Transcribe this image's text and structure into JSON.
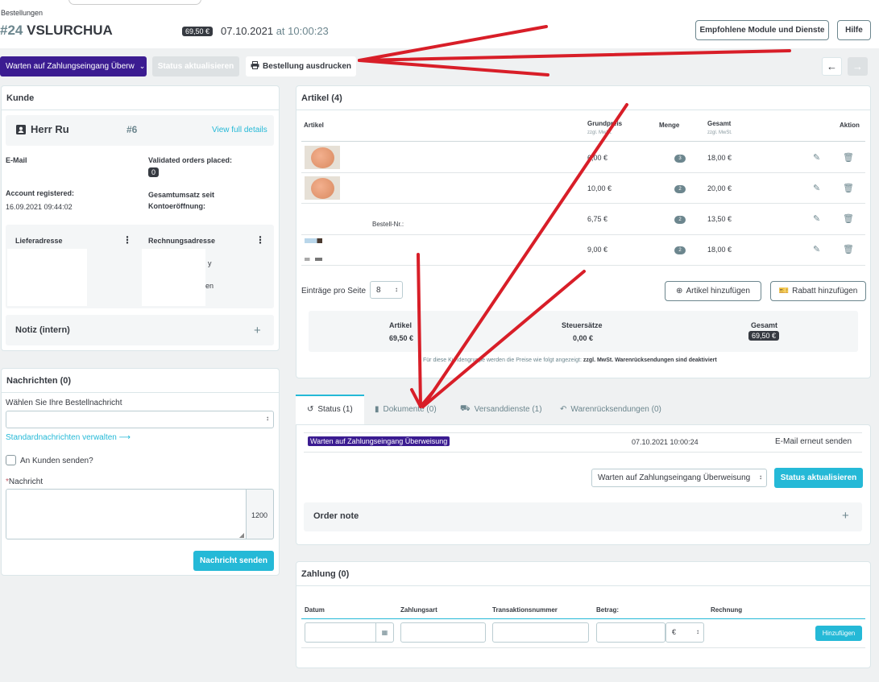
{
  "header": {
    "breadcrumb": "Bestellungen",
    "order_number": "#24",
    "order_reference": "VSLURCHUA",
    "total_badge": "69,50 €",
    "date": "07.10.2021",
    "at": "at",
    "time": "10:00:23",
    "recommended_button": "Empfohlene Module und Dienste",
    "help_button": "Hilfe"
  },
  "actionbar": {
    "status_dropdown": "Warten auf Zahlungseingang Überw",
    "update_status_button": "Status aktualisieren",
    "print_button": "Bestellung ausdrucken",
    "prev_icon": "arrow-left-icon",
    "next_icon": "arrow-right-icon"
  },
  "customer": {
    "title": "Kunde",
    "name": "Herr Ru",
    "id": "#6",
    "view_details": "View full details",
    "email_label": "E-Mail",
    "validated_label": "Validated orders placed:",
    "validated_count": "0",
    "registered_label": "Account registered:",
    "registered_value": "16.09.2021 09:44:02",
    "revenue_label": "Gesamtumsatz seit Kontoeröffnung:",
    "delivery_label": "Lieferadresse",
    "invoice_label": "Rechnungsadresse",
    "invoice_fragment_1": "y",
    "invoice_fragment_2": "en",
    "note_label": "Notiz (intern)",
    "note_add": "+"
  },
  "messages": {
    "title": "Nachrichten (0)",
    "choose_label": "Wählen Sie Ihre Bestellnachricht",
    "manage_link": "Standardnachrichten verwalten",
    "send_to_customer": "An Kunden senden?",
    "message_label": "Nachricht",
    "required_marker": "*",
    "char_count": "1200",
    "send_button": "Nachricht senden"
  },
  "products": {
    "title": "Artikel (4)",
    "col_article": "Artikel",
    "col_unit_price": "Grundpreis",
    "col_unit_price_sub": "zzgl. MwSt.",
    "col_qty": "Menge",
    "col_total": "Gesamt",
    "col_total_sub": "zzgl. MwSt.",
    "col_action": "Aktion",
    "rows": [
      {
        "price": "6,00 €",
        "qty": "3",
        "total": "18,00 €"
      },
      {
        "price": "10,00 €",
        "qty": "2",
        "total": "20,00 €"
      },
      {
        "price": "6,75 €",
        "qty": "2",
        "total": "13,50 €",
        "order_ref": "Bestell-Nr.:"
      },
      {
        "price": "9,00 €",
        "qty": "2",
        "total": "18,00 €"
      }
    ],
    "per_page_label": "Einträge pro Seite",
    "per_page_value": "8",
    "add_product_button": "Artikel hinzufügen",
    "add_discount_button": "Rabatt hinzufügen",
    "summary_articles_label": "Artikel",
    "summary_articles_value": "69,50 €",
    "summary_tax_label": "Steuersätze",
    "summary_tax_value": "0,00 €",
    "summary_total_label": "Gesamt",
    "summary_total_value": "69,50 €",
    "footnote_text": "Für diese Kundengruppe werden die Preise wie folgt angezeigt:",
    "footnote_tax": "zzgl. MwSt.",
    "footnote_returns": "Warenrücksendungen sind deaktiviert"
  },
  "tabs": [
    {
      "label": "Status (1)",
      "icon": "history-icon"
    },
    {
      "label": "Dokumente (0)",
      "icon": "file-icon"
    },
    {
      "label": "Versanddienste (1)",
      "icon": "truck-icon"
    },
    {
      "label": "Warenrücksendungen (0)",
      "icon": "undo-icon"
    }
  ],
  "status": {
    "current_label": "Warten auf Zahlungseingang Überweisung",
    "current_date": "07.10.2021 10:00:24",
    "resend_link": "E-Mail erneut senden",
    "select_value": "Warten auf Zahlungseingang Überweisung",
    "update_button": "Status aktualisieren",
    "order_note": "Order note",
    "order_note_add": "+"
  },
  "payment": {
    "title": "Zahlung (0)",
    "col_date": "Datum",
    "col_method": "Zahlungsart",
    "col_transaction": "Transaktionsnummer",
    "col_amount": "Betrag:",
    "col_invoice": "Rechnung",
    "currency": "€",
    "add_button": "Hinzufügen"
  },
  "colors": {
    "primary": "#25b9d7",
    "status_purple": "#3b1c91",
    "dark": "#363a41",
    "annotation_red": "#d81e28"
  }
}
